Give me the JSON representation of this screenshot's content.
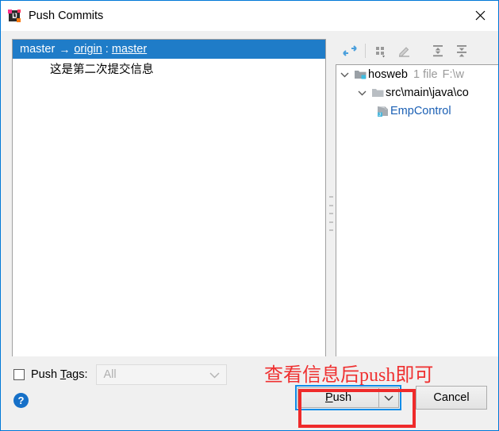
{
  "window": {
    "title": "Push Commits",
    "app_icon": "intellij-idea-icon",
    "close_icon": "close-icon",
    "active_border_color": "#0078d7"
  },
  "commit_panel": {
    "selected_row": {
      "local_branch": "master",
      "arrow": "→",
      "remote": "origin",
      "separator": ":",
      "remote_branch": "master",
      "selection_color": "#1f7cc8"
    },
    "commits": [
      {
        "message": "这是第二次提交信息"
      }
    ],
    "hscrollbar": "horizontal-scrollbar"
  },
  "splitter": {
    "name": "panel-splitter"
  },
  "tree_toolbar": {
    "buttons": [
      {
        "name": "collapse-diff-icon",
        "label": ""
      },
      {
        "name": "group-by-icon",
        "label": ""
      },
      {
        "name": "edit-source-icon",
        "label": ""
      },
      {
        "name": "expand-all-icon",
        "label": ""
      },
      {
        "name": "collapse-all-icon",
        "label": ""
      }
    ]
  },
  "file_tree": {
    "rows": [
      {
        "kind": "module",
        "expanded": true,
        "twisty": "chevron-down-icon",
        "icon": "module-folder-icon",
        "label": "hosweb",
        "meta": "1 file",
        "meta2": "F:\\w",
        "link": false
      },
      {
        "kind": "folder",
        "expanded": true,
        "twisty": "chevron-down-icon",
        "icon": "folder-icon",
        "label": "src\\main\\java\\co",
        "meta": "",
        "meta2": "",
        "link": false
      },
      {
        "kind": "file",
        "expanded": null,
        "twisty": "",
        "icon": "java-class-icon",
        "label": "EmpControl",
        "meta": "",
        "meta2": "",
        "link": true
      }
    ]
  },
  "bottom": {
    "push_tags": {
      "checkbox_name": "push-tags-checkbox",
      "label_pre": "Push ",
      "label_mnemonic": "T",
      "label_post": "ags:",
      "checked": false
    },
    "tags_select": {
      "value": "All",
      "disabled": true,
      "arrow": "chevron-down-icon",
      "options": [
        "All"
      ]
    },
    "help_button": {
      "glyph": "?"
    }
  },
  "buttons": {
    "push": {
      "label_pre": "",
      "label_mnemonic": "P",
      "label_post": "ush",
      "focused": true,
      "focus_color": "#0f8ce8",
      "dropdown_icon": "chevron-down-icon"
    },
    "cancel": {
      "label": "Cancel"
    }
  },
  "annotations": {
    "text": "查看信息后push即可",
    "color": "#ef3030",
    "highlight_rect_target": "push-button"
  }
}
